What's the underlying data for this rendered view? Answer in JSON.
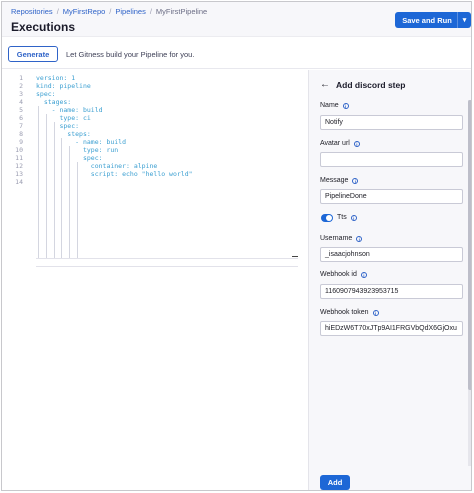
{
  "breadcrumb": {
    "items": [
      "Repositories",
      "MyFirstRepo",
      "Pipelines"
    ],
    "current": "MyFirstPipeline"
  },
  "page_title": "Executions",
  "save_run_label": "Save and Run",
  "generate": {
    "button_label": "Generate",
    "text": "Let Gitness build your Pipeline for you."
  },
  "editor": {
    "line_numbers": [
      "1",
      "2",
      "3",
      "4",
      "5",
      "6",
      "7",
      "8",
      "9",
      "10",
      "11",
      "12",
      "13",
      "14"
    ],
    "lines": [
      "version: 1",
      "kind: pipeline",
      "spec:",
      "  stages:",
      "    - name: build",
      "      type: ci",
      "      spec:",
      "        steps:",
      "          - name: build",
      "            type: run",
      "            spec:",
      "              container: alpine",
      "              script: echo \"hello world\"",
      ""
    ]
  },
  "panel": {
    "title": "Add discord step",
    "fields": {
      "name": {
        "label": "Name",
        "value": "Notify"
      },
      "avatar_url": {
        "label": "Avatar url",
        "value": ""
      },
      "message": {
        "label": "Message",
        "value": "PipelineDone"
      },
      "tts": {
        "label": "Tts",
        "checked": true
      },
      "username": {
        "label": "Username",
        "value": "_isaacjohnson"
      },
      "webhook_id": {
        "label": "Webhook id",
        "value": "1160907943923953715"
      },
      "webhook_token": {
        "label": "Webhook token",
        "value": "hiEDzW6T70xJTp9AI1FRGVbQdX6GjOxu"
      }
    },
    "add_label": "Add"
  },
  "colors": {
    "accent": "#1d67d6",
    "link": "#2f63c8",
    "code": "#3b9fd1"
  }
}
